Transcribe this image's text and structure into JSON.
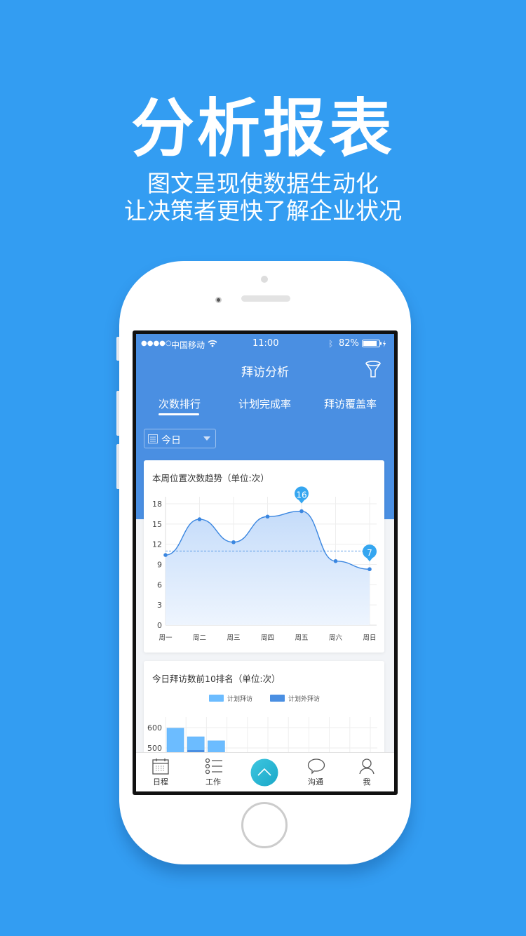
{
  "promo": {
    "headline": "分析报表",
    "line1": "图文呈现使数据生动化",
    "line2": "让决策者更快了解企业状况"
  },
  "status": {
    "signal": "●●●●○",
    "carrier": "中国移动",
    "time": "11:00",
    "battery": "82%"
  },
  "nav": {
    "title": "拜访分析",
    "filter_icon": "funnel-icon"
  },
  "tabs": [
    {
      "label": "次数排行",
      "active": true
    },
    {
      "label": "计划完成率"
    },
    {
      "label": "拜访覆盖率"
    }
  ],
  "date_select": {
    "value": "今日"
  },
  "colors": {
    "background": "#339df2",
    "header": "#4a8fe2",
    "line": "#3a86e0",
    "marker": "#35a6f0",
    "plan_bar": "#6cbcff",
    "unplanned_bar": "#4a8fe2"
  },
  "chart_data": [
    {
      "type": "area",
      "title": "本周位置次数趋势（单位:次）",
      "categories": [
        "周一",
        "周二",
        "周三",
        "周四",
        "周五",
        "周六",
        "周日"
      ],
      "values": [
        10.4,
        15.7,
        12.3,
        16.1,
        16.9,
        9.5,
        8.3
      ],
      "ylim": [
        0,
        18
      ],
      "yticks": [
        0,
        3,
        6,
        9,
        12,
        15,
        18
      ],
      "grid": true,
      "markers": [
        {
          "category": "周五",
          "label": "16"
        },
        {
          "category": "周日",
          "label": "7"
        }
      ],
      "reference_line": 11
    },
    {
      "type": "bar",
      "title": "今日拜访数前10排名（单位:次）",
      "legend": [
        "计划拜访",
        "计划外拜访"
      ],
      "legend_position": "top",
      "yticks": [
        500,
        600
      ],
      "series": [
        {
          "name": "计划拜访",
          "values": [
            597,
            555,
            535
          ]
        },
        {
          "name": "计划外拜访",
          "values": [
            null,
            null,
            null
          ]
        }
      ],
      "grid": true
    }
  ],
  "tabbar": [
    {
      "label": "日程",
      "icon": "calendar-icon"
    },
    {
      "label": "工作",
      "icon": "list-icon"
    },
    {
      "label": "",
      "icon": "chevron-up-icon"
    },
    {
      "label": "沟通",
      "icon": "chat-bubble-icon"
    },
    {
      "label": "我",
      "icon": "person-icon"
    }
  ]
}
